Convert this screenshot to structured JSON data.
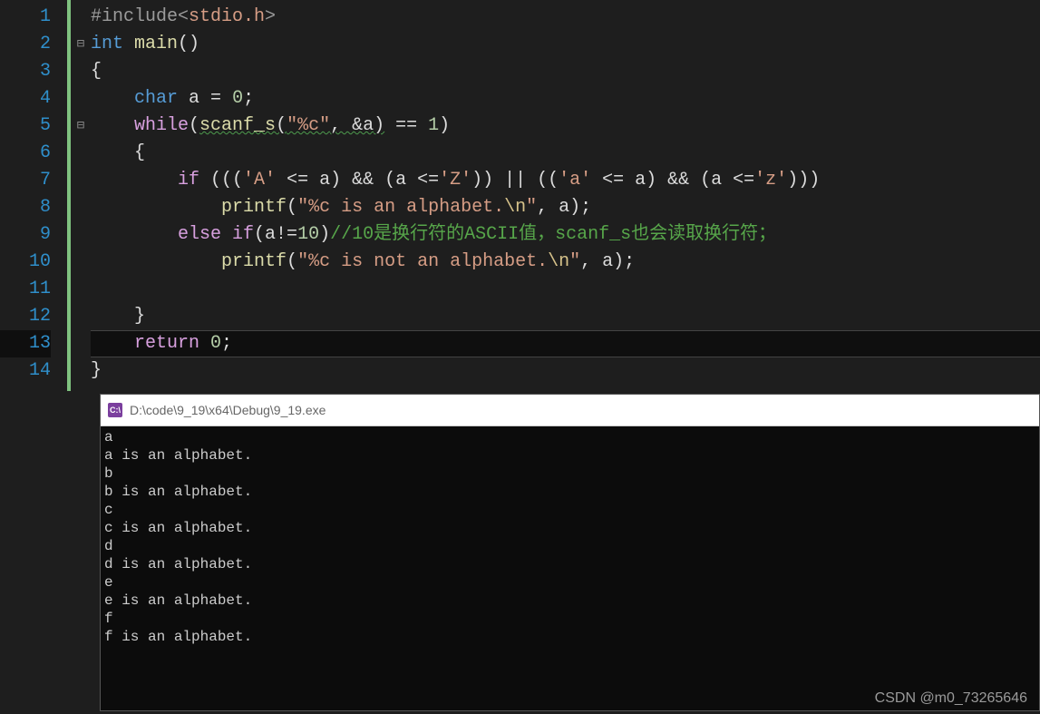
{
  "gutter": [
    "1",
    "2",
    "3",
    "4",
    "5",
    "6",
    "7",
    "8",
    "9",
    "10",
    "11",
    "12",
    "13",
    "14"
  ],
  "fold": {
    "l2": "⊟",
    "l5": "⊟"
  },
  "tokens": {
    "l1_preproc": "#include",
    "l1_angle_open": "<",
    "l1_header": "stdio.h",
    "l1_angle_close": ">",
    "l2_kw": "int",
    "l2_func": "main",
    "l2_par": "()",
    "l3_brace": "{",
    "l4_kw": "char",
    "l4_ident": " a ",
    "l4_eq": "=",
    "l4_num": " 0",
    "l4_semi": ";",
    "l5_kw": "while",
    "l5_po": "(",
    "l5_scanf": "scanf_s",
    "l5_po2": "(",
    "l5_str": "\"%c\"",
    "l5_comma": ", &a",
    "l5_pc": ")",
    "l5_eq": " == ",
    "l5_one": "1",
    "l5_pc2": ")",
    "l6_brace": "{",
    "l7_if": "if",
    "l7_expr_a": " (((",
    "l7_charA": "'A'",
    "l7_le1": " <= a) && (a <=",
    "l7_charZ": "'Z'",
    "l7_mid": ")) || ((",
    "l7_chara": "'a'",
    "l7_le2": " <= a) && (a <=",
    "l7_charz": "'z'",
    "l7_end": ")))",
    "l8_printf": "printf",
    "l8_po": "(",
    "l8_str1": "\"%c is an alphabet.",
    "l8_esc": "\\n",
    "l8_str2": "\"",
    "l8_args": ", a);",
    "l9_else": "else",
    "l9_if": " if",
    "l9_po": "(a!=",
    "l9_ten": "10",
    "l9_pc": ")",
    "l9_comment": "//10是换行符的ASCII值，scanf_s也会读取换行符；",
    "l10_printf": "printf",
    "l10_po": "(",
    "l10_str1": "\"%c is not an alphabet.",
    "l10_esc": "\\n",
    "l10_str2": "\"",
    "l10_args": ", a);",
    "l12_brace": "}",
    "l13_ret": "return",
    "l13_zero": " 0",
    "l13_semi": ";",
    "l14_brace": "}"
  },
  "console": {
    "title": "D:\\code\\9_19\\x64\\Debug\\9_19.exe",
    "icon_text": "C:\\",
    "output": "a\na is an alphabet.\nb\nb is an alphabet.\nc\nc is an alphabet.\nd\nd is an alphabet.\ne\ne is an alphabet.\nf\nf is an alphabet."
  },
  "watermark": "CSDN @m0_73265646"
}
